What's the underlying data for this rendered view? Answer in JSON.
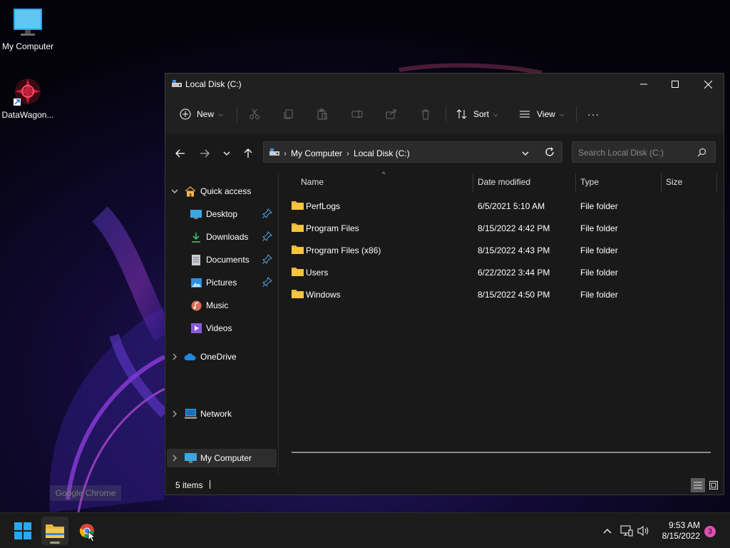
{
  "desktop": {
    "icons": [
      {
        "label": "My Computer"
      },
      {
        "label": "DataWagon..."
      }
    ],
    "tooltip": "Google Chrome"
  },
  "window": {
    "title": "Local Disk (C:)",
    "toolbar": {
      "new_label": "New",
      "sort_label": "Sort",
      "view_label": "View",
      "more_label": "···"
    },
    "address": {
      "crumbs": [
        "My Computer",
        "Local Disk (C:)"
      ]
    },
    "search": {
      "placeholder": "Search Local Disk (C:)"
    },
    "sidebar": {
      "quick_access": "Quick access",
      "items": [
        {
          "label": "Desktop"
        },
        {
          "label": "Downloads"
        },
        {
          "label": "Documents"
        },
        {
          "label": "Pictures"
        },
        {
          "label": "Music"
        },
        {
          "label": "Videos"
        }
      ],
      "onedrive": "OneDrive",
      "my_computer": "My Computer",
      "network": "Network"
    },
    "columns": {
      "name": "Name",
      "date": "Date modified",
      "type": "Type",
      "size": "Size"
    },
    "files": [
      {
        "name": "PerfLogs",
        "date": "6/5/2021 5:10 AM",
        "type": "File folder"
      },
      {
        "name": "Program Files",
        "date": "8/15/2022 4:42 PM",
        "type": "File folder"
      },
      {
        "name": "Program Files (x86)",
        "date": "8/15/2022 4:43 PM",
        "type": "File folder"
      },
      {
        "name": "Users",
        "date": "6/22/2022 3:44 PM",
        "type": "File folder"
      },
      {
        "name": "Windows",
        "date": "8/15/2022 4:50 PM",
        "type": "File folder"
      }
    ],
    "status": {
      "item_count": "5 items"
    }
  },
  "taskbar": {
    "time": "9:53 AM",
    "date": "8/15/2022",
    "notification_count": "3"
  },
  "colors": {
    "accent": "#0078d4",
    "folder": "#f5c542",
    "window_bg": "#191919",
    "notification": "#e04fb3"
  }
}
